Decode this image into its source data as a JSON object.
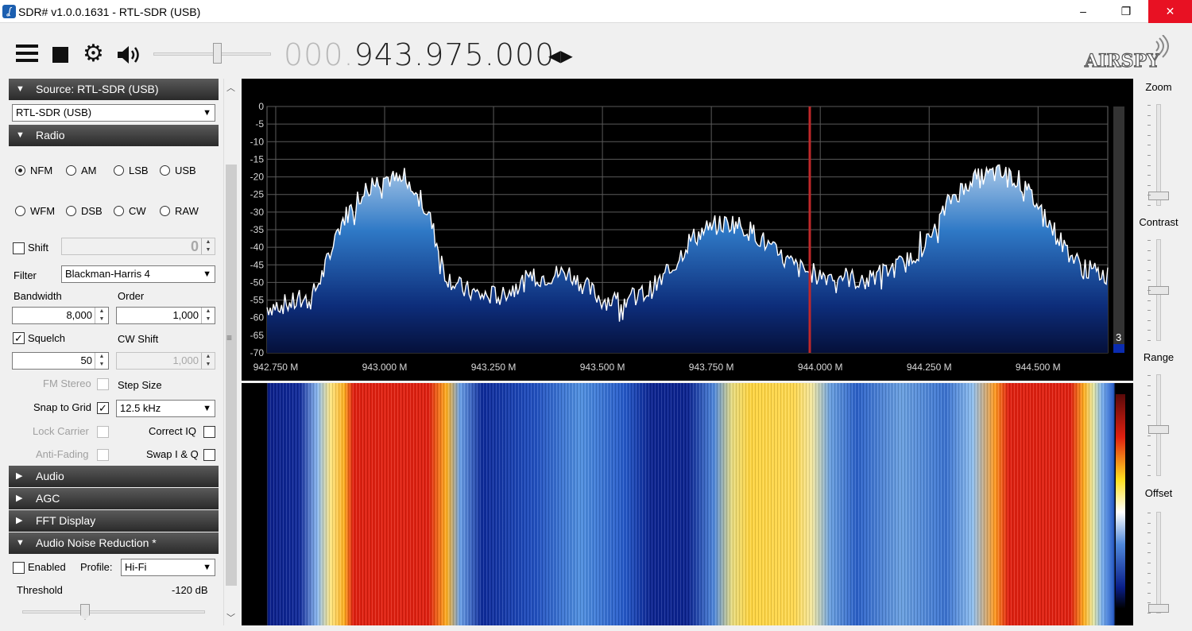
{
  "window": {
    "title": "SDR# v1.0.0.1631 - RTL-SDR (USB)",
    "minimize": "–",
    "maximize": "❐",
    "close": "✕"
  },
  "toolbar": {
    "frequency_prefix": "000.",
    "frequency_main": "943.975.000",
    "tune_arrows": "◀▶",
    "volume_level": 0.55,
    "logo_text": "AIRSPY"
  },
  "panels": {
    "source_header": "Source: RTL-SDR (USB)",
    "source_device": "RTL-SDR (USB)",
    "radio_header": "Radio",
    "modes": [
      {
        "label": "NFM",
        "selected": true
      },
      {
        "label": "AM",
        "selected": false
      },
      {
        "label": "LSB",
        "selected": false
      },
      {
        "label": "USB",
        "selected": false
      },
      {
        "label": "WFM",
        "selected": false
      },
      {
        "label": "DSB",
        "selected": false
      },
      {
        "label": "CW",
        "selected": false
      },
      {
        "label": "RAW",
        "selected": false
      }
    ],
    "shift_label": "Shift",
    "shift_value": "0",
    "filter_label": "Filter",
    "filter_value": "Blackman-Harris 4",
    "bandwidth_label": "Bandwidth",
    "bandwidth_value": "8,000",
    "order_label": "Order",
    "order_value": "1,000",
    "squelch_label": "Squelch",
    "squelch_value": "50",
    "cw_shift_label": "CW Shift",
    "cw_shift_value": "1,000",
    "fm_stereo_label": "FM Stereo",
    "step_size_label": "Step Size",
    "snap_label": "Snap to Grid",
    "step_value": "12.5 kHz",
    "lock_carrier_label": "Lock Carrier",
    "correct_iq_label": "Correct IQ",
    "anti_fading_label": "Anti-Fading",
    "swap_iq_label": "Swap I & Q",
    "audio_header": "Audio",
    "agc_header": "AGC",
    "fft_header": "FFT Display",
    "anr_header": "Audio Noise Reduction *",
    "enabled_label": "Enabled",
    "profile_label": "Profile:",
    "profile_value": "Hi-Fi",
    "threshold_label": "Threshold",
    "threshold_value": "-120 dB"
  },
  "right_panel": {
    "zoom_label": "Zoom",
    "contrast_label": "Contrast",
    "range_label": "Range",
    "offset_label": "Offset",
    "zoom_level": 0.05,
    "contrast_level": 0.5,
    "range_level": 0.45,
    "offset_level": 0.0
  },
  "spectrum": {
    "marker_value": "3",
    "center_frequency_mhz": 943.975
  },
  "chart_data": {
    "type": "area",
    "title": "",
    "xlabel": "",
    "ylabel": "",
    "x_ticks": [
      "942.750 M",
      "943.000 M",
      "943.250 M",
      "943.500 M",
      "943.750 M",
      "944.000 M",
      "944.250 M",
      "944.500 M"
    ],
    "x_tick_values": [
      942.75,
      943.0,
      943.25,
      943.5,
      943.75,
      944.0,
      944.25,
      944.5
    ],
    "y_ticks": [
      "0",
      "-5",
      "-10",
      "-15",
      "-20",
      "-25",
      "-30",
      "-35",
      "-40",
      "-45",
      "-50",
      "-55",
      "-60",
      "-65",
      "-70"
    ],
    "xlim": [
      942.73,
      944.66
    ],
    "ylim": [
      -70,
      0
    ],
    "grid": true,
    "series": [
      {
        "x": [
          942.73,
          942.78,
          942.83,
          942.86,
          942.9,
          942.95,
          943.0,
          943.05,
          943.1,
          943.14,
          943.18,
          943.23,
          943.28,
          943.33,
          943.38,
          943.42,
          943.46,
          943.5,
          943.55,
          943.6,
          943.65,
          943.7,
          943.75,
          943.8,
          943.85,
          943.9,
          943.95,
          944.0,
          944.05,
          944.1,
          944.15,
          944.2,
          944.25,
          944.3,
          944.35,
          944.4,
          944.45,
          944.5,
          944.55,
          944.6,
          944.66
        ],
        "y": [
          -57,
          -56,
          -55,
          -47,
          -33,
          -24,
          -20,
          -22,
          -30,
          -48,
          -52,
          -54,
          -53,
          -49,
          -48,
          -47,
          -51,
          -55,
          -55,
          -53,
          -48,
          -38,
          -34,
          -33,
          -36,
          -42,
          -46,
          -48,
          -48,
          -50,
          -47,
          -44,
          -38,
          -26,
          -21,
          -19,
          -20,
          -28,
          -38,
          -46,
          -48
        ]
      }
    ]
  }
}
